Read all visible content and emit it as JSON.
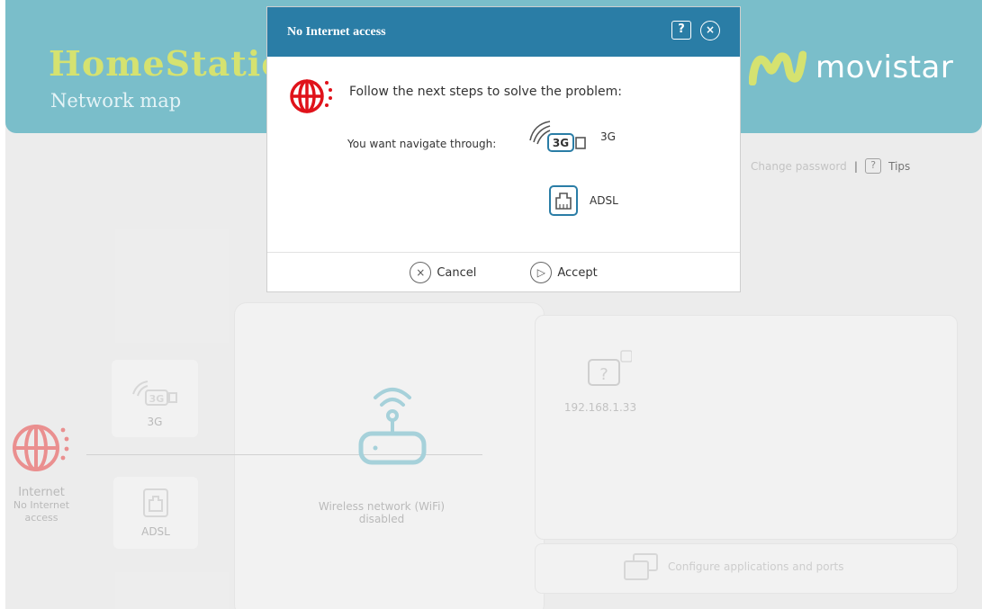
{
  "app": {
    "brand": "HomeStatio",
    "subtitle": "Network map",
    "operator": "movistar",
    "change_password": "Change password",
    "separator": "|",
    "tips_icon": "?",
    "tips": "Tips"
  },
  "map": {
    "internet": {
      "label": "Internet",
      "status_line1": "No Internet",
      "status_line2": "access"
    },
    "option_3g": {
      "label": "3G",
      "badge": "3G"
    },
    "option_adsl": {
      "label": "ADSL"
    },
    "wifi": {
      "line1": "Wireless network (WiFi)",
      "line2": "disabled"
    },
    "device": {
      "ip": "192.168.1.33",
      "icon_char": "?"
    },
    "apps_link": "Configure applications and ports"
  },
  "dialog": {
    "title": "No Internet access",
    "help_icon": "?",
    "close_icon": "×",
    "message": "Follow the next steps to solve the problem:",
    "question": "You want navigate through:",
    "option_3g_label": "3G",
    "option_3g_badge": "3G",
    "option_adsl_label": "ADSL",
    "cancel_icon": "×",
    "cancel_label": "Cancel",
    "accept_icon": "▷",
    "accept_label": "Accept"
  },
  "colors": {
    "header_bg": "#3c9fb2",
    "dialog_title_bg": "#2a7da6",
    "brand_green": "#c2d52d",
    "alert_red": "#e0121a"
  },
  "icons": [
    "globe-alert-icon",
    "signal-3g-icon",
    "ethernet-port-icon",
    "router-wifi-icon",
    "unknown-device-icon",
    "apps-ports-icon",
    "help-icon",
    "close-icon",
    "cancel-icon",
    "accept-icon",
    "movistar-logo"
  ]
}
